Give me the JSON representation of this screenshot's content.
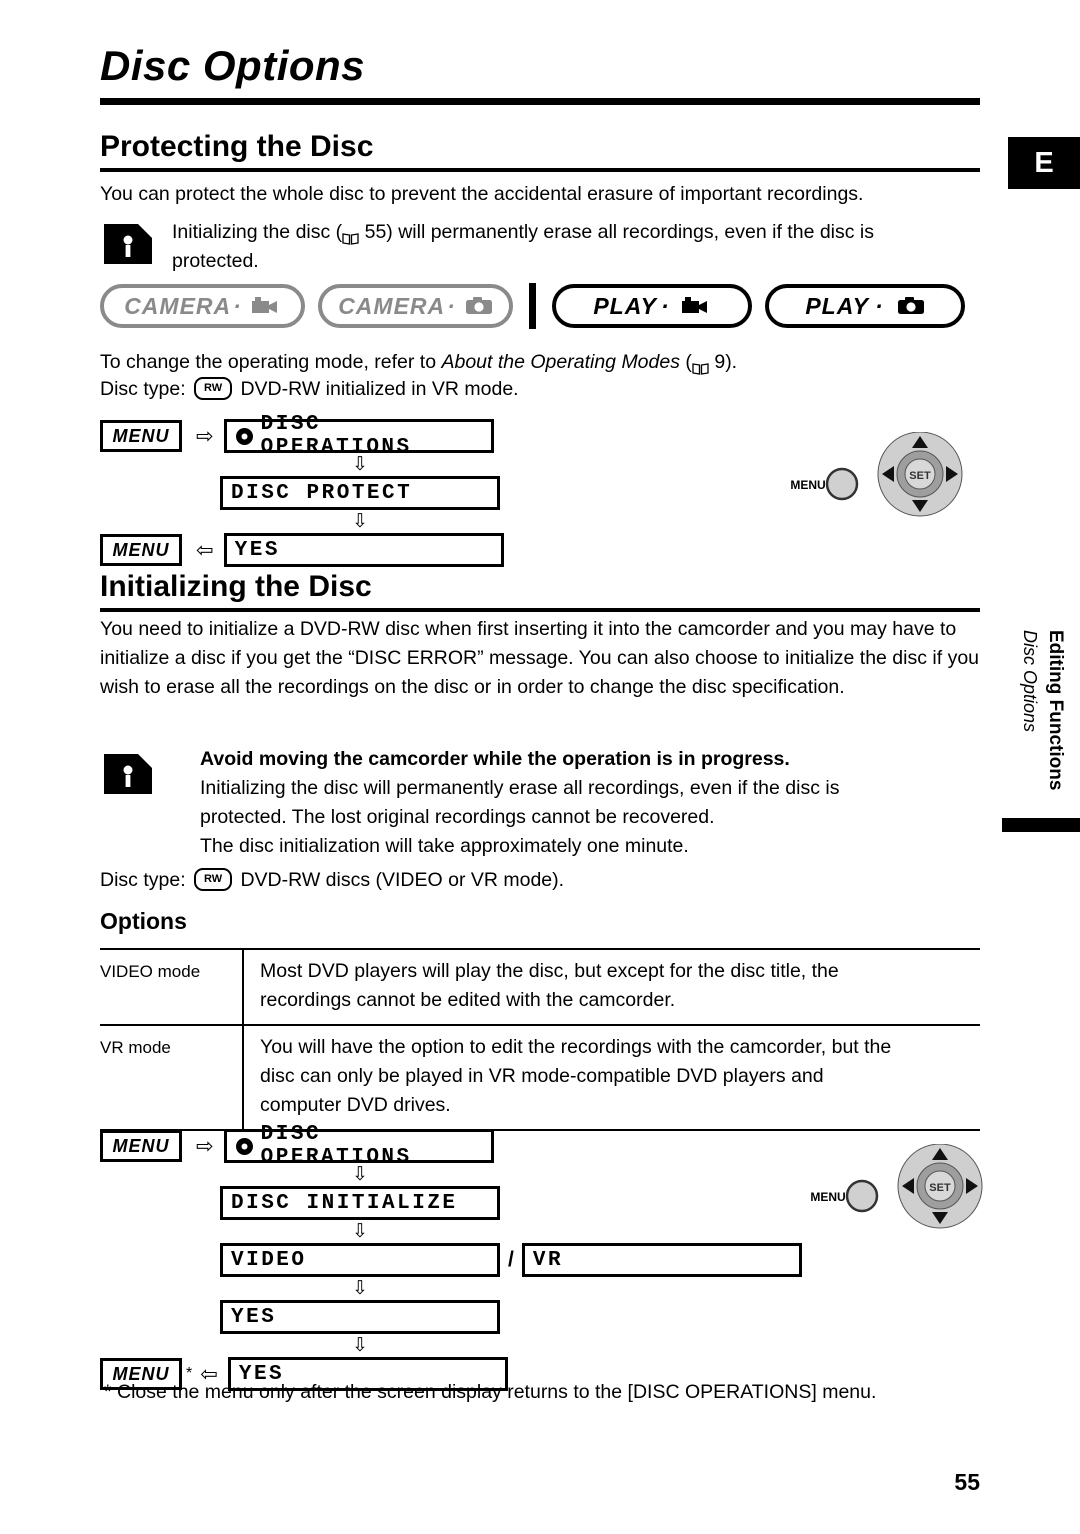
{
  "document": {
    "chapter_title": "Disc Options",
    "edition_tab": "E",
    "page_number": "55",
    "side_tab_line1": "Editing Functions",
    "side_tab_line2": "Disc Options"
  },
  "section_protect": {
    "heading": "Protecting the Disc",
    "intro": "You can protect the whole disc to prevent the accidental erasure of important recordings.",
    "warning_line1_a": "Initializing the disc (",
    "warning_page_ref": "55",
    "warning_line1_b": ") will permanently erase all recordings, even if the disc is",
    "warning_line2": "protected.",
    "modes": [
      {
        "label": "CAMERA",
        "dot": "·",
        "icon": "movie-camera-icon",
        "state": "disabled"
      },
      {
        "label": "CAMERA",
        "dot": "·",
        "icon": "still-camera-icon",
        "state": "disabled"
      },
      {
        "label": "PLAY",
        "dot": "·",
        "icon": "movie-camera-icon",
        "state": "enabled"
      },
      {
        "label": "PLAY",
        "dot": "·",
        "icon": "still-camera-icon",
        "state": "enabled"
      }
    ],
    "mode_note_a": "To change the operating mode, refer to ",
    "mode_note_italic": "About the Operating Modes",
    "mode_note_b": " (",
    "mode_note_page": "9",
    "mode_note_c": ").",
    "disc_type_label": "Disc type:",
    "disc_type_badge": "RW",
    "disc_type_value": "DVD-RW initialized in VR mode.",
    "flow": {
      "menu_chip": "MENU",
      "step1": "DISC OPERATIONS",
      "step2": "DISC PROTECT",
      "step3": "YES",
      "arrow_right": "⇨",
      "arrow_left": "⇦",
      "arrow_down": "⇩"
    },
    "joystick": {
      "menu_label": "MENU",
      "set_label": "SET"
    }
  },
  "section_initialize": {
    "heading": "Initializing the Disc",
    "paragraph": "You need to initialize a DVD-RW disc when first inserting it into the camcorder and you may have to initialize a disc if you get the “DISC ERROR” message. You can also choose to initialize the disc if you wish to erase all the recordings on the disc or in order to change the disc specification.",
    "warning_bold": "Avoid moving the camcorder while the operation is in progress.",
    "warning_line1": "Initializing the disc will permanently erase all recordings, even if the disc is",
    "warning_line2": "protected. The lost original recordings cannot be recovered.",
    "warning_line3": "The disc initialization will take approximately one minute.",
    "disc_type_label": "Disc type:",
    "disc_type_badge": "RW",
    "disc_type_value": "DVD-RW discs (VIDEO or VR mode).",
    "options_heading": "Options",
    "options_rows": [
      {
        "mode": "VIDEO mode",
        "desc_line1": "Most DVD players will play the disc, but except for the disc title, the",
        "desc_line2": "recordings cannot be edited with the camcorder.",
        "desc_line3": ""
      },
      {
        "mode": "VR mode",
        "desc_line1": "You will have the option to edit the recordings with the camcorder, but the",
        "desc_line2": "disc can only be played in VR mode-compatible DVD players and",
        "desc_line3": "computer DVD drives."
      }
    ],
    "flow": {
      "menu_chip": "MENU",
      "step1": "DISC OPERATIONS",
      "step2": "DISC INITIALIZE",
      "step3a": "VIDEO",
      "separator": "/",
      "step3b": "VR",
      "step4": "YES",
      "step5": "YES",
      "asterisk": "*",
      "arrow_right": "⇨",
      "arrow_left": "⇦",
      "arrow_down": "⇩"
    },
    "joystick": {
      "menu_label": "MENU",
      "set_label": "SET"
    },
    "footnote": "* Close the menu only after the screen display returns to the [DISC OPERATIONS] menu."
  }
}
